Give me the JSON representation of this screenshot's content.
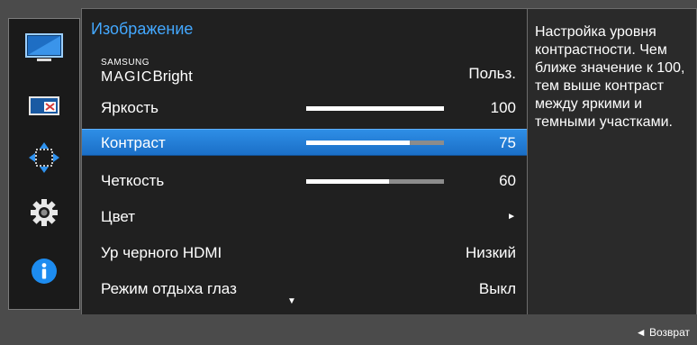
{
  "panel": {
    "title": "Изображение"
  },
  "menu": {
    "magic_brand": "SAMSUNG",
    "magic_word": "MAGIC",
    "magic_suffix": "Bright",
    "magic_value": "Польз.",
    "items": [
      {
        "label": "Яркость",
        "value": "100",
        "level": 1.0
      },
      {
        "label": "Контраст",
        "value": "75",
        "level": 0.75
      },
      {
        "label": "Четкость",
        "value": "60",
        "level": 0.6
      },
      {
        "label": "Цвет",
        "value": "►"
      },
      {
        "label": "Ур черного HDMI",
        "value": "Низкий"
      },
      {
        "label": "Режим отдыха глаз",
        "value": "Выкл"
      }
    ],
    "more_indicator": "▼"
  },
  "info": {
    "text": "Настройка уровня контрастности. Чем ближе значение к 100, тем выше контраст между яркими и темными участками."
  },
  "footer": {
    "back_label": "◄ Возврат"
  },
  "icons": [
    "monitor-icon",
    "picture-size-icon",
    "position-icon",
    "settings-gear-icon",
    "information-icon"
  ],
  "colors": {
    "accent": "#43a8ff",
    "selected": "#1f78d2",
    "info_icon": "#1d8cf0"
  }
}
